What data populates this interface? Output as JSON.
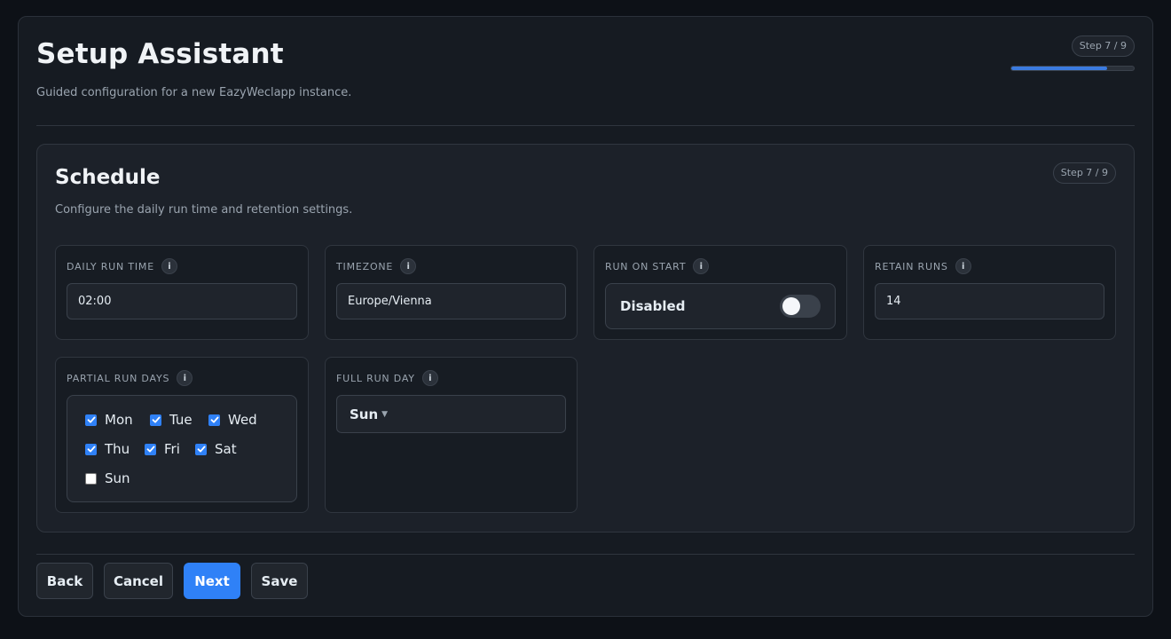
{
  "header": {
    "title": "Setup Assistant",
    "subtitle": "Guided configuration for a new EazyWeclapp instance.",
    "step": "Step 7 / 9",
    "progress_fraction": 0.78
  },
  "section": {
    "title": "Schedule",
    "subtitle": "Configure the daily run time and retention settings.",
    "step": "Step 7 / 9"
  },
  "fields": {
    "daily_run_time": {
      "label": "DAILY RUN TIME",
      "value": "02:00"
    },
    "timezone": {
      "label": "TIMEZONE",
      "value": "Europe/Vienna"
    },
    "run_on_start": {
      "label": "RUN ON START",
      "value": "Disabled",
      "enabled": false
    },
    "retain_runs": {
      "label": "RETAIN RUNS",
      "value": "14"
    },
    "partial_run_days": {
      "label": "PARTIAL RUN DAYS",
      "days": [
        {
          "label": "Mon",
          "checked": true
        },
        {
          "label": "Tue",
          "checked": true
        },
        {
          "label": "Wed",
          "checked": true
        },
        {
          "label": "Thu",
          "checked": true
        },
        {
          "label": "Fri",
          "checked": true
        },
        {
          "label": "Sat",
          "checked": true
        },
        {
          "label": "Sun",
          "checked": false
        }
      ]
    },
    "full_run_day": {
      "label": "FULL RUN DAY",
      "value": "Sun"
    }
  },
  "info_icon": "i",
  "footer": {
    "back": "Back",
    "cancel": "Cancel",
    "next": "Next",
    "save": "Save"
  },
  "colors": {
    "accent": "#2f81f7",
    "background": "#0d1117",
    "panel": "#161b22"
  }
}
